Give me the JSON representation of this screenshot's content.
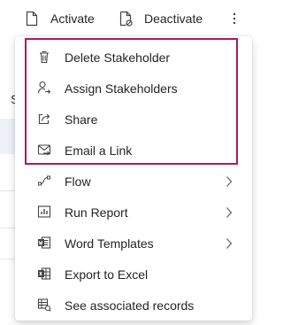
{
  "commandbar": {
    "activate_label": "Activate",
    "deactivate_label": "Deactivate",
    "more_icon": "more-vertical-icon"
  },
  "background": {
    "partial_letter": "S"
  },
  "menu": {
    "items": [
      {
        "label": "Delete Stakeholder",
        "icon": "delete-icon",
        "submenu": false
      },
      {
        "label": "Assign Stakeholders",
        "icon": "assign-person-icon",
        "submenu": false
      },
      {
        "label": "Share",
        "icon": "share-icon",
        "submenu": false
      },
      {
        "label": "Email a Link",
        "icon": "email-link-icon",
        "submenu": false
      },
      {
        "label": "Flow",
        "icon": "flow-icon",
        "submenu": true
      },
      {
        "label": "Run Report",
        "icon": "report-icon",
        "submenu": true
      },
      {
        "label": "Word Templates",
        "icon": "word-icon",
        "submenu": true
      },
      {
        "label": "Export to Excel",
        "icon": "excel-icon",
        "submenu": false
      },
      {
        "label": "See associated records",
        "icon": "associated-records-icon",
        "submenu": false
      }
    ]
  },
  "colors": {
    "highlight_border": "#b0185c",
    "text": "#242424",
    "icon": "#424242"
  }
}
